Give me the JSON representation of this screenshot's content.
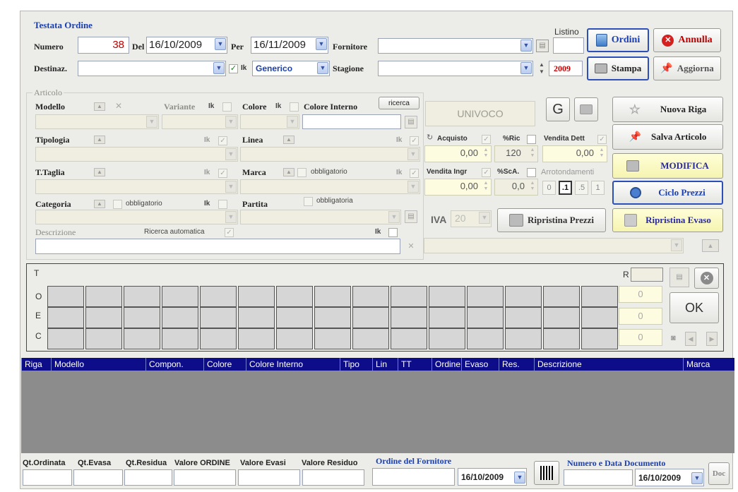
{
  "header": {
    "section_title": "Testata Ordine",
    "numero_label": "Numero",
    "numero_value": "38",
    "del_label": "Del",
    "del_date": "16/10/2009",
    "per_label": "Per",
    "per_date": "16/11/2009",
    "fornitore_label": "Fornitore",
    "fornitore_value": "",
    "listino_label": "Listino",
    "destinaz_label": "Destinaz.",
    "ik_label": "Ik",
    "generico_value": "Generico",
    "stagione_label": "Stagione",
    "stagione_year": "2009"
  },
  "buttons": {
    "ordini": "Ordini",
    "annulla": "Annulla",
    "stampa": "Stampa",
    "aggiorna": "Aggiorna",
    "ricerca": "ricerca",
    "univoco": "UNIVOCO",
    "g": "G",
    "nuova_riga": "Nuova Riga",
    "salva_articolo": "Salva Articolo",
    "modifica": "MODIFICA",
    "ciclo_prezzi": "Ciclo Prezzi",
    "ripristina_prezzi": "Ripristina Prezzi",
    "ripristina_evaso": "Ripristina Evaso",
    "ok": "OK",
    "doc": "Doc"
  },
  "articolo": {
    "section_title": "Articolo",
    "modello": "Modello",
    "variante": "Variante",
    "ik": "Ik",
    "colore": "Colore",
    "colore_interno": "Colore Interno",
    "tipologia": "Tipologia",
    "linea": "Linea",
    "t_taglia": "T.Taglia",
    "marca": "Marca",
    "obbligatorio": "obbligatorio",
    "obbligatoria": "obbligatoria",
    "categoria": "Categoria",
    "partita": "Partita",
    "descrizione": "Descrizione",
    "ricerca_automatica": "Ricerca automatica",
    "acquisto": "Acquisto",
    "ric": "%Ric",
    "vendita_dett": "Vendita Dett",
    "acquisto_value": "0,00",
    "ric_value": "120",
    "vendita_dett_value": "0,00",
    "vendita_ingr": "Vendita Ingr",
    "sca": "%ScA.",
    "arrotondamenti": "Arrotondamenti",
    "vendita_ingr_value": "0,00",
    "sca_value": "0,0",
    "round_options": [
      "0",
      ".1",
      ".5",
      "1"
    ],
    "iva_label": "IVA",
    "iva_value": "20"
  },
  "grid": {
    "row_labels": [
      "T",
      "O",
      "E",
      "C"
    ],
    "r_label": "R",
    "totals": [
      "0",
      "0",
      "0"
    ]
  },
  "table": {
    "columns": [
      "Riga",
      "Modello",
      "Compon.",
      "Colore",
      "Colore Interno",
      "Tipo",
      "Lin",
      "TT",
      "Ordine",
      "Evaso",
      "Res.",
      "Descrizione",
      "Marca"
    ]
  },
  "footer": {
    "qt_ordinata": "Qt.Ordinata",
    "qt_evasa": "Qt.Evasa",
    "qt_residua": "Qt.Residua",
    "valore_ordine": "Valore ORDINE",
    "valore_evasi": "Valore Evasi",
    "valore_residuo": "Valore Residuo",
    "ordine_fornitore": "Ordine del Fornitore",
    "ordine_date": "16/10/2009",
    "numero_data_doc": "Numero e Data Documento",
    "doc_date": "16/10/2009"
  },
  "colors": {
    "accent_blue": "#1a3fb0",
    "table_header": "#0d0d8a",
    "table_body": "#8c8c8c",
    "numero_red": "#c00000"
  }
}
